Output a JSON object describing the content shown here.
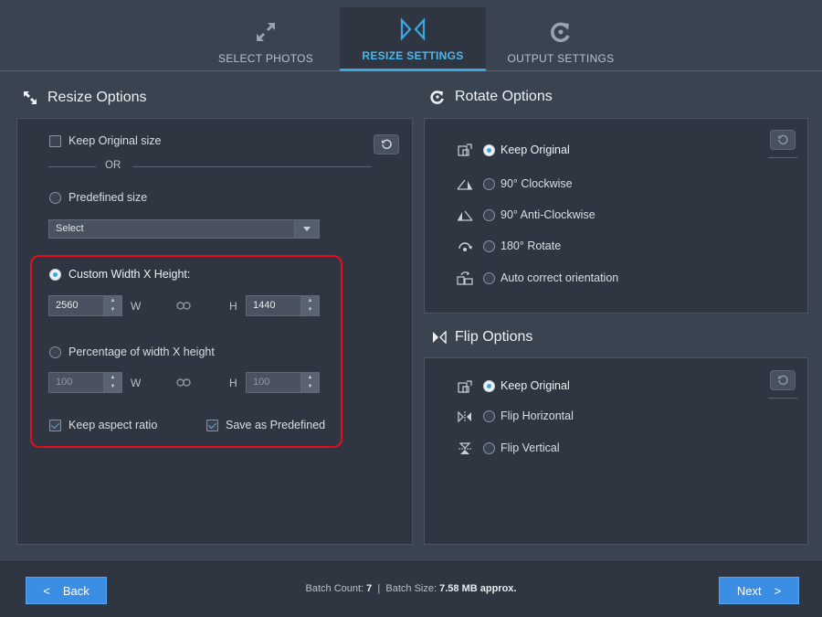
{
  "tabs": [
    {
      "label": "SELECT PHOTOS",
      "icon": "expand-arrows-icon"
    },
    {
      "label": "RESIZE SETTINGS",
      "icon": "resize-settings-icon"
    },
    {
      "label": "OUTPUT SETTINGS",
      "icon": "output-settings-icon"
    }
  ],
  "resize": {
    "title": "Resize Options",
    "keep_original": "Keep Original size",
    "or": "OR",
    "predefined": "Predefined size",
    "select_value": "Select",
    "custom": "Custom Width X Height:",
    "custom_width": "2560",
    "custom_height": "1440",
    "w_label": "W",
    "h_label": "H",
    "percentage": "Percentage of width X height",
    "pct_width": "100",
    "pct_height": "100",
    "keep_aspect": "Keep aspect ratio",
    "save_predefined": "Save as Predefined"
  },
  "rotate": {
    "title": "Rotate Options",
    "options": [
      "Keep Original",
      "90° Clockwise",
      "90° Anti-Clockwise",
      "180° Rotate",
      "Auto correct orientation"
    ]
  },
  "flip": {
    "title": "Flip Options",
    "options": [
      "Keep Original",
      "Flip Horizontal",
      "Flip Vertical"
    ]
  },
  "footer": {
    "back": "Back",
    "next": "Next",
    "batch_count_label": "Batch Count:",
    "batch_count": "7",
    "separator": "|",
    "batch_size_label": "Batch Size:",
    "batch_size": "7.58 MB approx."
  },
  "colors": {
    "accent": "#3aa7e0",
    "button": "#3c8ee4",
    "highlight": "#e0101a",
    "panel": "#2f3641",
    "background": "#3a4350"
  }
}
